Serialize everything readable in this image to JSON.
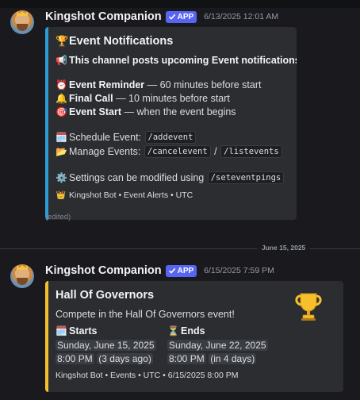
{
  "messages": [
    {
      "author": "Kingshot Companion",
      "badge": "APP",
      "timestamp": "6/13/2025 12:01 AM",
      "embed": {
        "accent_color": "#2d9bd6",
        "title": "Event Notifications",
        "title_icon": "trophy-icon",
        "description": "This channel posts upcoming Event notifications!",
        "reminders": [
          {
            "icon": "alarm-clock-icon",
            "label": "Event Reminder",
            "text": "— 60 minutes before start"
          },
          {
            "icon": "bell-icon",
            "label": "Final Call",
            "text": "— 10 minutes before start"
          },
          {
            "icon": "target-icon",
            "label": "Event Start",
            "text": "— when the event begins"
          }
        ],
        "schedule_label": "Schedule Event:",
        "schedule_cmd": "/addevent",
        "manage_label": "Manage Events:",
        "manage_cmd_1": "/cancelevent",
        "manage_sep": "/",
        "manage_cmd_2": "/listevents",
        "settings_label": "Settings can be modified using",
        "settings_cmd": "/seteventpings",
        "footer": "Kingshot Bot • Event Alerts • UTC"
      },
      "edited": "(edited)"
    },
    {
      "author": "Kingshot Companion",
      "badge": "APP",
      "timestamp": "6/15/2025 7:59 PM",
      "embed": {
        "accent_color": "#f4c12c",
        "title": "Hall Of Governors",
        "description": "Compete in the Hall Of Governors event!",
        "starts_label": "Starts",
        "starts_date": "Sunday, June 15, 2025",
        "starts_time": "8:00 PM",
        "starts_relative": "3 days ago",
        "ends_label": "Ends",
        "ends_date": "Sunday, June 22, 2025",
        "ends_time": "8:00 PM",
        "ends_relative": "in 4 days",
        "footer": "Kingshot Bot • Events • UTC • 6/15/2025 8:00 PM"
      }
    }
  ],
  "date_divider": "June 15, 2025"
}
